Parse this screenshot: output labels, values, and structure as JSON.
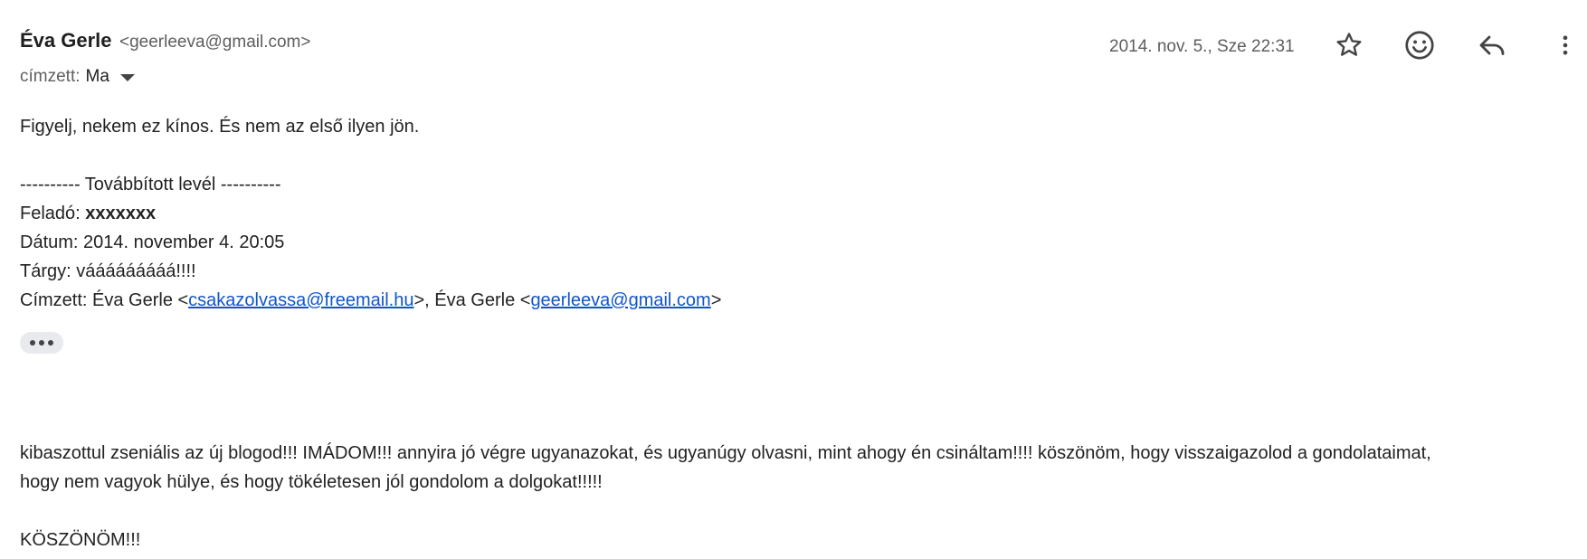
{
  "header": {
    "sender_name": "Éva Gerle",
    "sender_email": "<geerleeva@gmail.com>",
    "recipient_label": "címzett:",
    "recipient_name": "Ma",
    "date": "2014. nov. 5., Sze 22:31"
  },
  "toolbar": {
    "icons": [
      "star-icon",
      "emoji-icon",
      "reply-icon",
      "more-vert-icon"
    ]
  },
  "message": {
    "intro": "Figyelj, nekem ez kínos. És nem az első ilyen jön.",
    "forward_separator": "---------- Továbbított levél ----------",
    "from_label": "Feladó: ",
    "from_value": "xxxxxxx",
    "date_line": "Dátum: 2014. november 4. 20:05",
    "subject_line": "Tárgy: vááááááááá!!!!",
    "to_label": "Címzett: Éva Gerle <",
    "to_email1": "csakazolvassa@freemail.hu",
    "to_mid": ">, Éva Gerle <",
    "to_email2": "geerleeva@gmail.com",
    "to_end": ">",
    "content_line1": "kibaszottul zseniális az új blogod!!! IMÁDOM!!! annyira jó végre ugyanazokat, és ugyanúgy olvasni, mint ahogy én csináltam!!!! köszönöm, hogy visszaigazolod a gondolataimat,",
    "content_line2": "hogy nem vagyok hülye, és hogy tökéletesen jól gondolom a dolgokat!!!!!",
    "closing": "KÖSZÖNÖM!!!"
  }
}
